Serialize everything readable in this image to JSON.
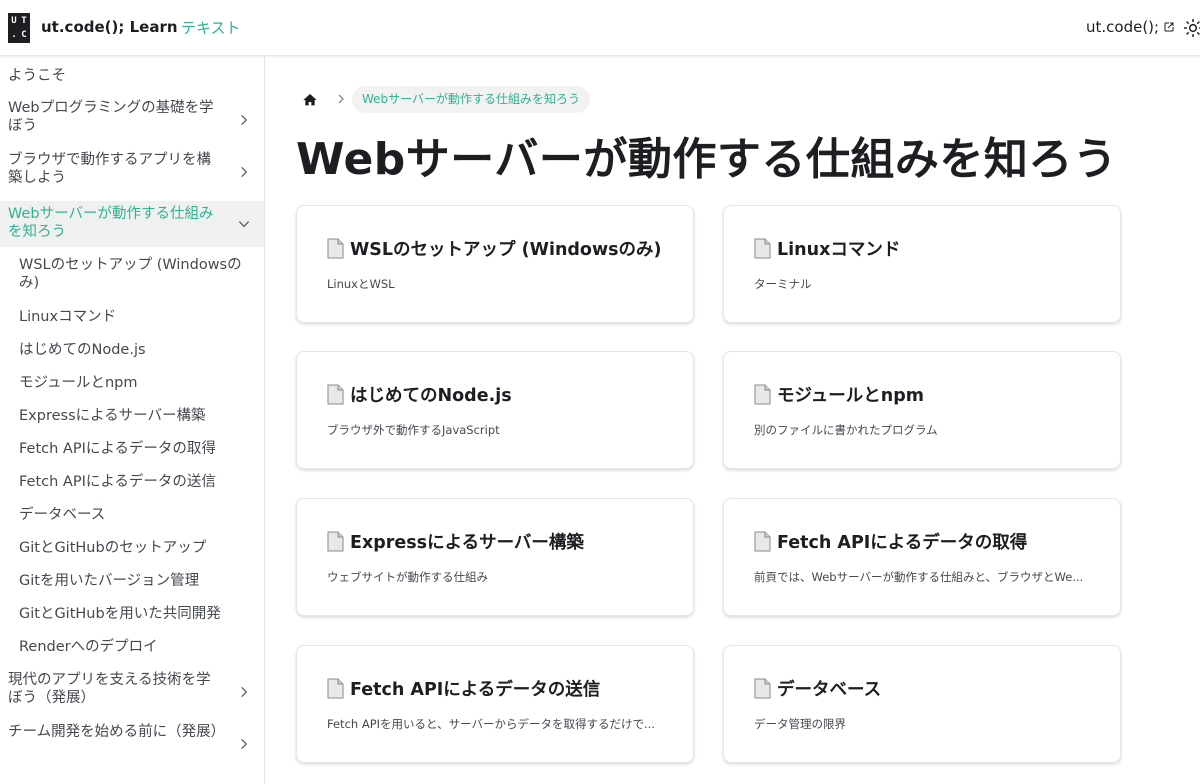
{
  "navbar": {
    "logo": [
      "U",
      "T",
      ".",
      "C"
    ],
    "brand": "ut.code(); Learn",
    "text_link": "テキスト",
    "external_link": "ut.code();"
  },
  "sidebar": {
    "items": [
      {
        "label": "ようこそ"
      },
      {
        "label": "Webプログラミングの基礎を学ぼう",
        "expandable": true
      },
      {
        "label": "ブラウザで動作するアプリを構築しよう",
        "expandable": true
      },
      {
        "label": "Webサーバーが動作する仕組みを知ろう",
        "expandable": true,
        "expanded": true,
        "active": true
      },
      {
        "label": "WSLのセットアップ (Windowsのみ)"
      },
      {
        "label": "Linuxコマンド"
      },
      {
        "label": "はじめてのNode.js"
      },
      {
        "label": "モジュールとnpm"
      },
      {
        "label": "Expressによるサーバー構築"
      },
      {
        "label": "Fetch APIによるデータの取得"
      },
      {
        "label": "Fetch APIによるデータの送信"
      },
      {
        "label": "データベース"
      },
      {
        "label": "GitとGitHubのセットアップ"
      },
      {
        "label": "Gitを用いたバージョン管理"
      },
      {
        "label": "GitとGitHubを用いた共同開発"
      },
      {
        "label": "Renderへのデプロイ"
      },
      {
        "label": "現代のアプリを支える技術を学ぼう（発展）",
        "expandable": true
      },
      {
        "label": "チーム開発を始める前に（発展）",
        "expandable": true
      }
    ]
  },
  "breadcrumb": {
    "current": "Webサーバーが動作する仕組みを知ろう"
  },
  "page_title": "Webサーバーが動作する仕組みを知ろう",
  "cards": [
    {
      "title": "WSLのセットアップ (Windowsのみ)",
      "desc": "LinuxとWSL"
    },
    {
      "title": "Linuxコマンド",
      "desc": "ターミナル"
    },
    {
      "title": "はじめてのNode.js",
      "desc": "ブラウザ外で動作するJavaScript"
    },
    {
      "title": "モジュールとnpm",
      "desc": "別のファイルに書かれたプログラム"
    },
    {
      "title": "Expressによるサーバー構築",
      "desc": "ウェブサイトが動作する仕組み"
    },
    {
      "title": "Fetch APIによるデータの取得",
      "desc": "前頁では、Webサーバーが動作する仕組みと、ブラウザとWe..."
    },
    {
      "title": "Fetch APIによるデータの送信",
      "desc": "Fetch APIを用いると、サーバーからデータを取得するだけで..."
    },
    {
      "title": "データベース",
      "desc": "データ管理の限界"
    }
  ],
  "colors": {
    "accent": "#2fb392",
    "text": "#1c1e21",
    "muted": "#444950"
  }
}
